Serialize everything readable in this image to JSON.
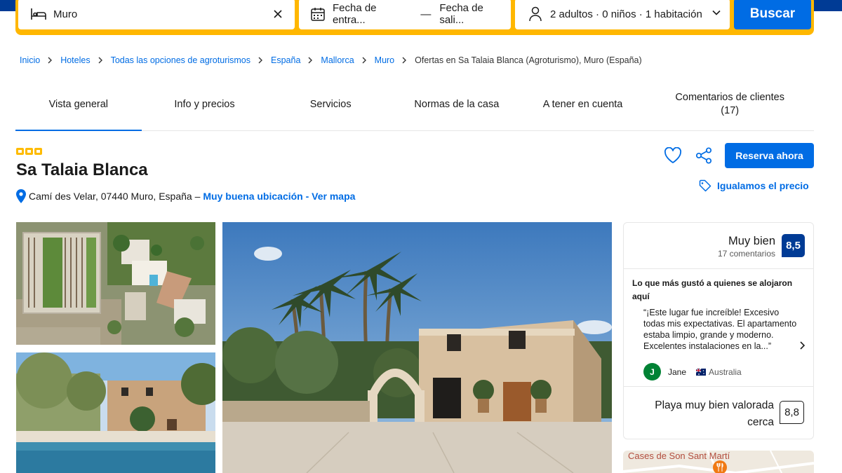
{
  "search": {
    "destination_value": "Muro",
    "checkin_placeholder": "Fecha de entra...",
    "checkout_placeholder": "Fecha de sali...",
    "dates_separator": "—",
    "guests_value": "2 adultos · 0 niños · 1 habitación",
    "button_label": "Buscar"
  },
  "breadcrumb": [
    "Inicio",
    "Hoteles",
    "Todas las opciones de agroturismos",
    "España",
    "Mallorca",
    "Muro",
    "Ofertas en Sa Talaia Blanca (Agroturismo), Muro (España)"
  ],
  "tabs": [
    {
      "label": "Vista general",
      "active": true
    },
    {
      "label": "Info y precios",
      "active": false
    },
    {
      "label": "Servicios",
      "active": false
    },
    {
      "label": "Normas de la casa",
      "active": false
    },
    {
      "label": "A tener en cuenta",
      "active": false
    },
    {
      "label": "Comentarios de clientes (17)",
      "active": false
    }
  ],
  "property": {
    "stars": 3,
    "name": "Sa Talaia Blanca",
    "address": "Camí des Velar, 07440 Muro, España –",
    "location_link": "Muy buena ubicación - Ver mapa",
    "reserve_label": "Reserva ahora",
    "price_match_label": "Igualamos el precio"
  },
  "reviews": {
    "score_word": "Muy bien",
    "count_text": "17 comentarios",
    "score": "8,5",
    "liked_title": "Lo que más gustó a quienes se alojaron aquí",
    "quote": "“¡Este lugar fue increíble! Excesivo todas mis expectativas. El apartamento estaba limpio, grande y moderno. Excelentes instalaciones en la...”",
    "reviewer_initial": "J",
    "reviewer_name": "Jane",
    "reviewer_country": "Australia",
    "beach_text": "Playa muy bien valorada cerca",
    "beach_score": "8,8"
  },
  "map": {
    "label": "Cases de Son Sant Martí"
  },
  "colors": {
    "brand_blue": "#003b95",
    "action_blue": "#006ce4",
    "search_yellow": "#ffb700",
    "star_yellow": "#febb02",
    "avatar_green": "#008234"
  }
}
